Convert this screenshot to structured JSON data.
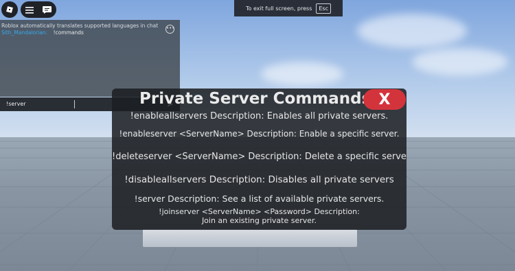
{
  "fullscreen_banner": {
    "text": "To exit full screen, press",
    "key": "Esc"
  },
  "chat": {
    "system_message": "Roblox automatically translates supported languages in chat",
    "messages": [
      {
        "user": "Sith_Mandalorian:",
        "text": "!commands"
      }
    ],
    "input_value": "!server",
    "more_icon": "ellipsis-icon",
    "send_icon": "send-arrow-icon"
  },
  "panel": {
    "title": "Private Server Commands",
    "close_label": "X",
    "commands": [
      "!enableallservers  Description: Enables all private servers.",
      "!enableserver <ServerName> Description: Enable a specific server.",
      "!deleteserver <ServerName> Description: Delete a specific server",
      "!disableallservers  Description: Disables all private servers",
      "!server  Description: See a list of available private servers.",
      "!joinserver <ServerName> <Password> Description: Join an existing private server."
    ]
  },
  "colors": {
    "close_button": "#d3343c",
    "chat_username": "#3aa8e8"
  },
  "icons": [
    "roblox-logo-icon",
    "menu-icon",
    "chat-icon"
  ]
}
